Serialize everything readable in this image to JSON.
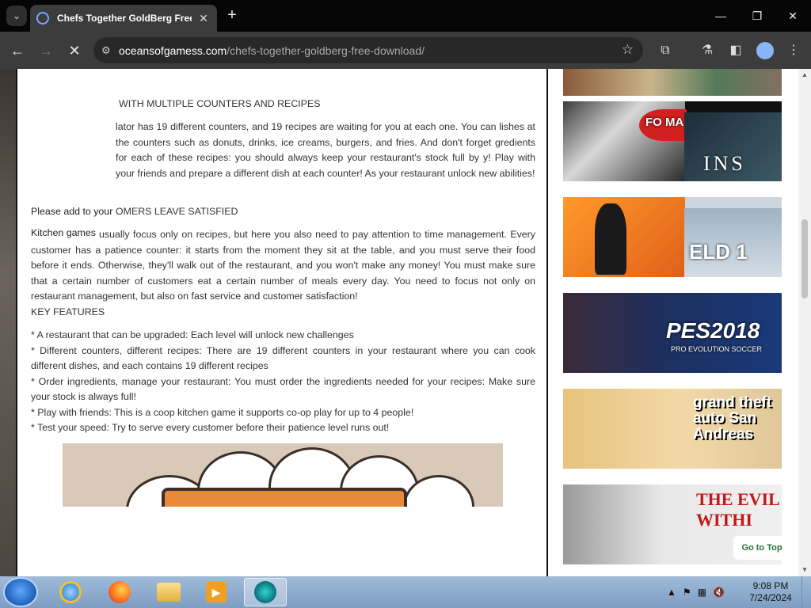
{
  "browser": {
    "tab_title": "Chefs Together GoldBerg Free",
    "url_domain": "oceansofgamess.com",
    "url_path": "/chefs-together-goldberg-free-download/",
    "close_tab": "✕",
    "new_tab": "+",
    "dropdown": "⌄"
  },
  "article": {
    "heading1": "WITH MULTIPLE COUNTERS AND RECIPES",
    "para1": "lator has 19 different counters, and 19 recipes are waiting for you at each one. You can lishes at the counters such as donuts, drinks, ice creams, burgers, and fries. And don't forget gredients for each of these recipes: you should always keep your restaurant's stock full by y! Play with your friends and prepare a different dish at each counter! As your restaurant unlock new abilities!",
    "overlay_note": "Please add to your",
    "heading2": "OMERS LEAVE SATISFIED",
    "overlay_note2": "Kitchen games",
    "para2": "usually focus only on recipes, but here you also need to pay attention to time management. Every customer has a patience counter: it starts from the moment they sit at the table, and you must serve their food before it ends. Otherwise, they'll walk out of the restaurant, and you won't make any money! You must make sure that a certain number of customers eat a certain number of meals every day. You need to focus not only on restaurant management, but also on fast service and customer satisfaction!",
    "key_features_title": "KEY FEATURES",
    "features": [
      "* A restaurant that can be upgraded: Each level will unlock new challenges",
      "* Different counters, different recipes: There are 19 different counters in your restaurant where you can cook different dishes, and each contains 19 different recipes",
      "* Order ingredients, manage your restaurant: You must order the ingredients needed for your recipes: Make sure your stock is always full!",
      "* Play with friends: This is a coop kitchen game it supports co-op play for up to 4 people!",
      "* Test your speed: Try to serve every customer before their patience level runs out!"
    ]
  },
  "sidebar": {
    "thumbs": [
      {
        "label": "",
        "color": "#7a6a55"
      },
      {
        "label": "FO MA",
        "color": "#222428"
      },
      {
        "label": "ELD 1",
        "color": "#c0ccd6"
      },
      {
        "label": "PES2018",
        "color": "#1d2f5e"
      },
      {
        "label": "grand theft auto San Andreas",
        "color": "#e2c488"
      },
      {
        "label": "THE EVIL WITHI",
        "color": "#d9d9d9"
      }
    ],
    "thumb1b_text": "INS",
    "pes_subtitle": "PRO EVOLUTION SOCCER",
    "go_top": "Go to Top"
  },
  "taskbar": {
    "time": "9:08 PM",
    "date": "7/24/2024"
  }
}
